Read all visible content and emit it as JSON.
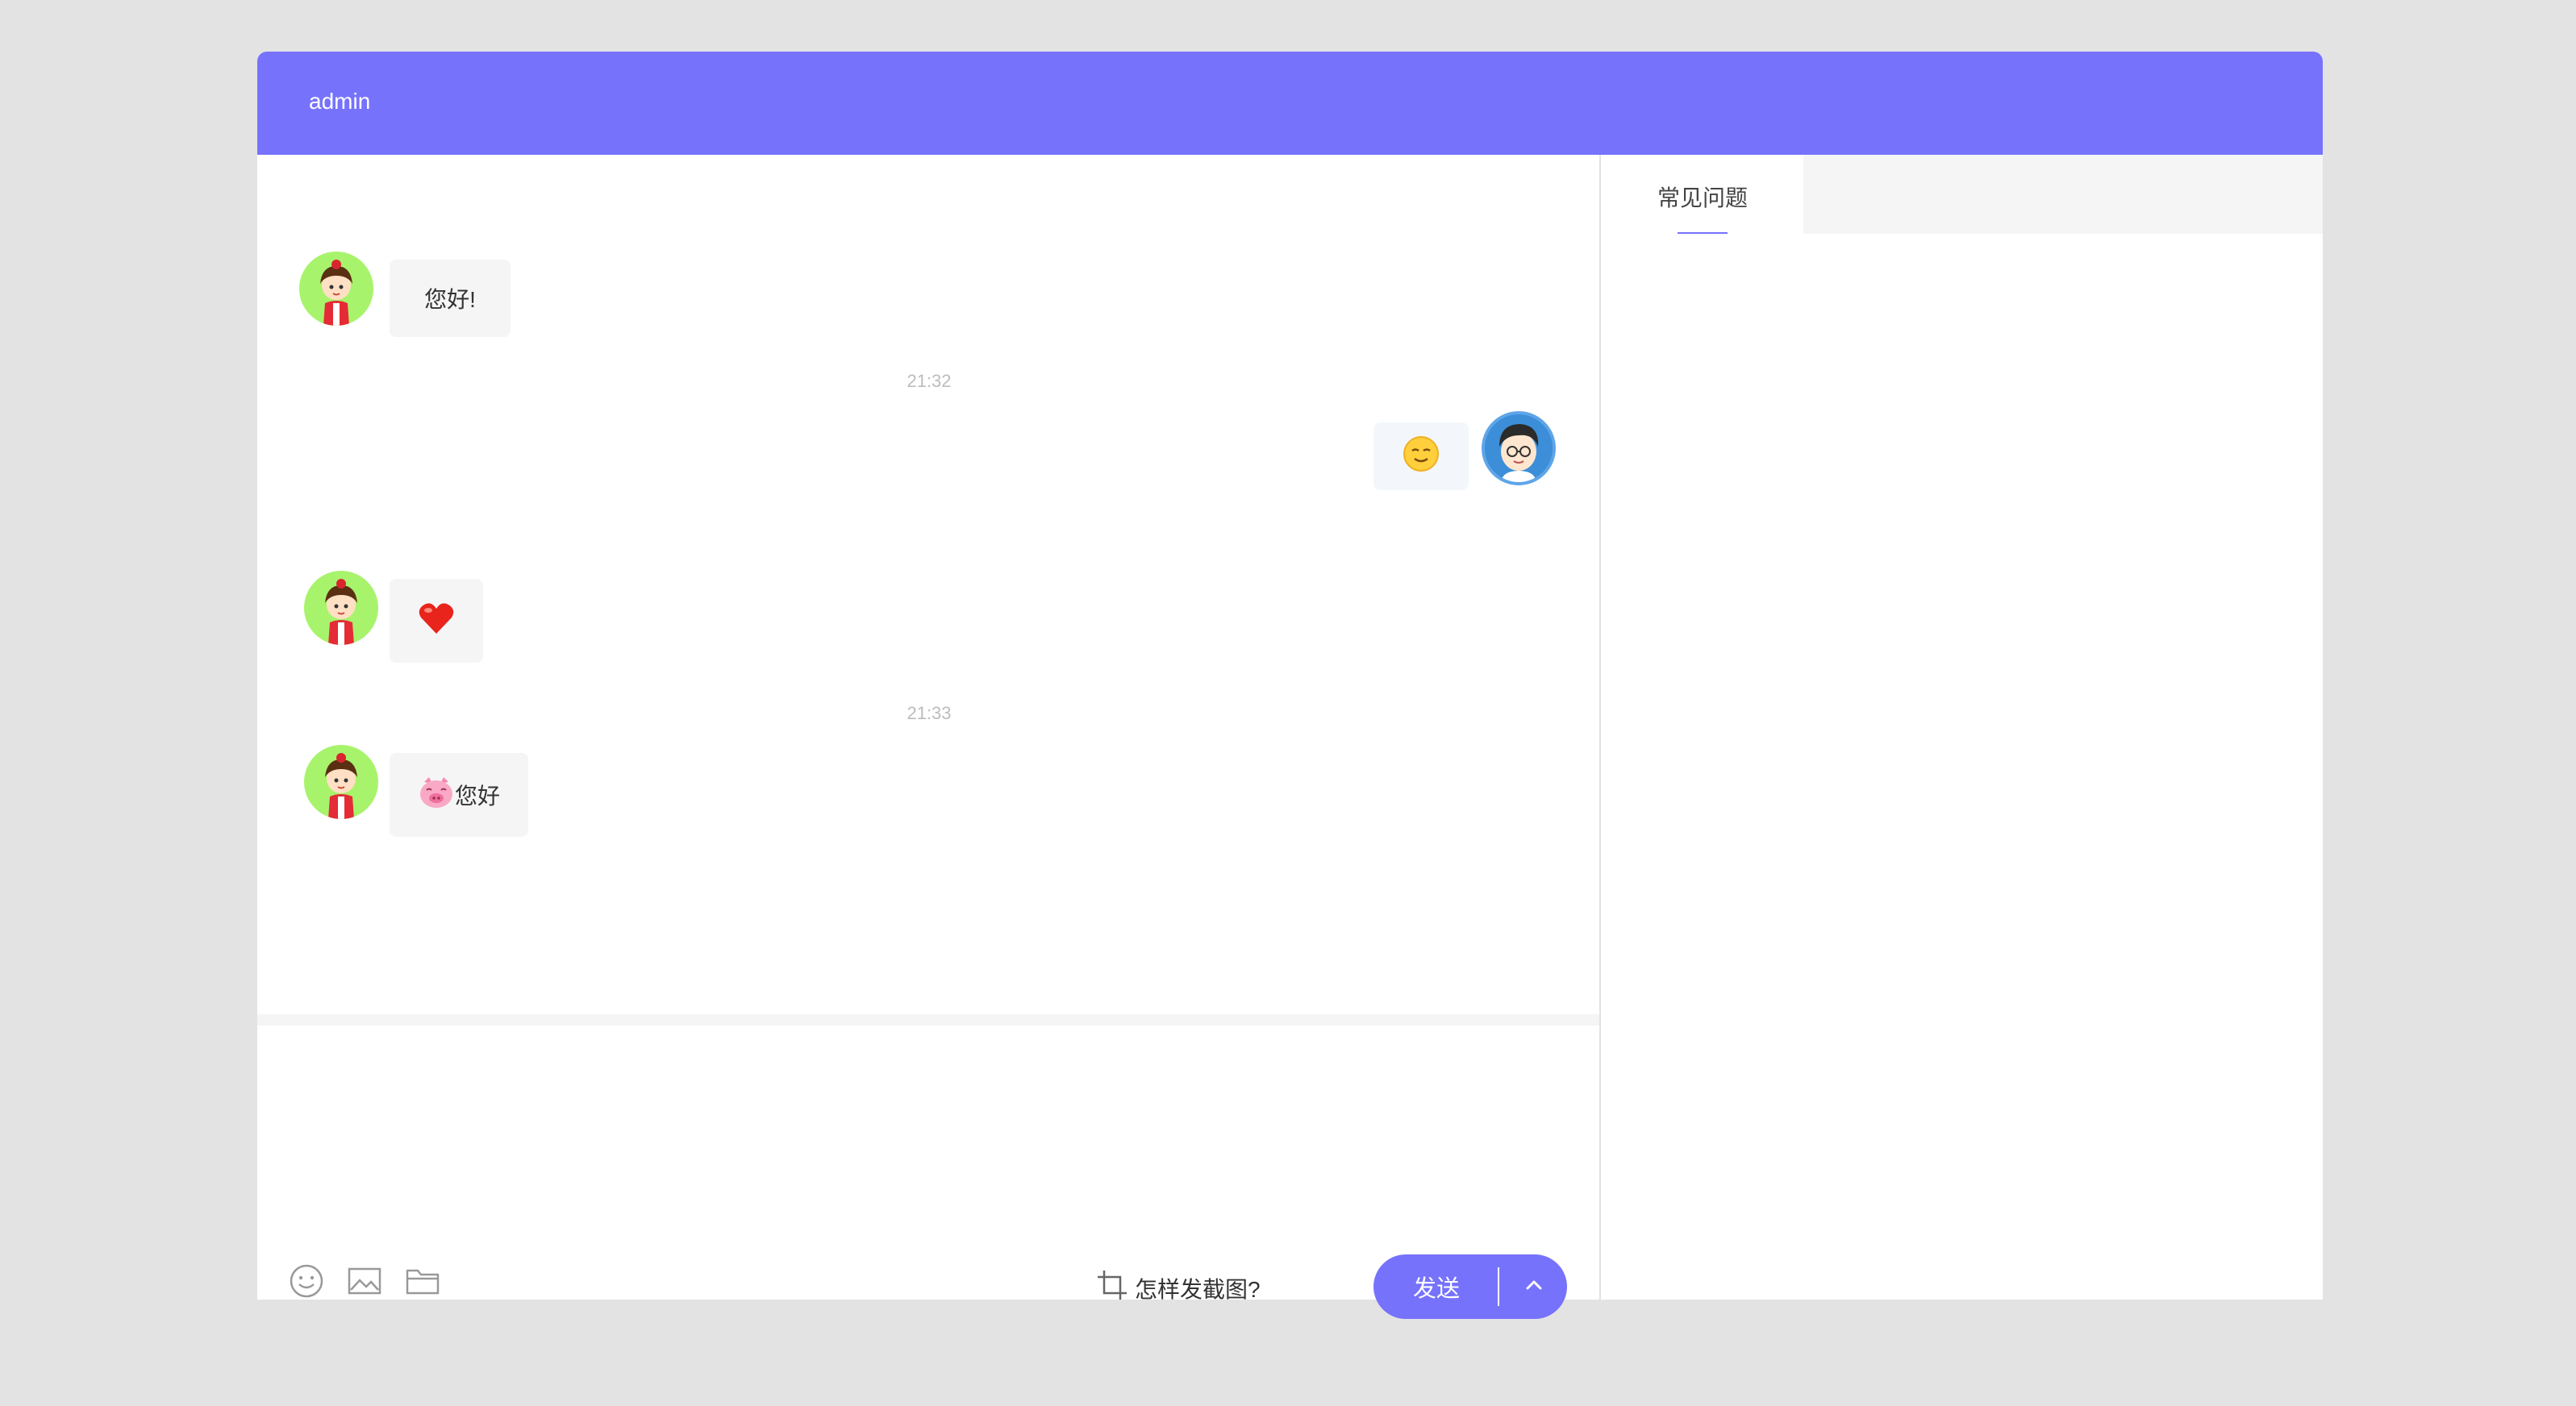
{
  "header": {
    "title": "admin"
  },
  "side_panel": {
    "tabs": [
      {
        "label": "常见问题",
        "active": true
      }
    ]
  },
  "messages": [
    {
      "sender": "visitor",
      "avatar": "girl-avatar",
      "text": "您好!"
    },
    {
      "timestamp": "21:32"
    },
    {
      "sender": "agent",
      "avatar": "admin-avatar",
      "emoji": "smiling-face-emoji"
    },
    {
      "sender": "visitor",
      "avatar": "girl-avatar",
      "emoji": "red-heart-emoji"
    },
    {
      "timestamp": "21:33"
    },
    {
      "sender": "visitor",
      "avatar": "girl-avatar",
      "emoji": "pig-face-emoji",
      "text": "您好"
    }
  ],
  "toolbar": {
    "icons": [
      "emoji-icon",
      "image-icon",
      "folder-icon"
    ],
    "screenshot_help": "怎样发截图?",
    "screenshot_icon": "crop-icon",
    "send_label": "发送",
    "send_options_icon": "chevron-up-icon"
  },
  "colors": {
    "accent": "#7672fc",
    "background": "#e3e3e4",
    "bubble": "#f5f5f5",
    "visitor_avatar_bg": "#a8f36c"
  }
}
